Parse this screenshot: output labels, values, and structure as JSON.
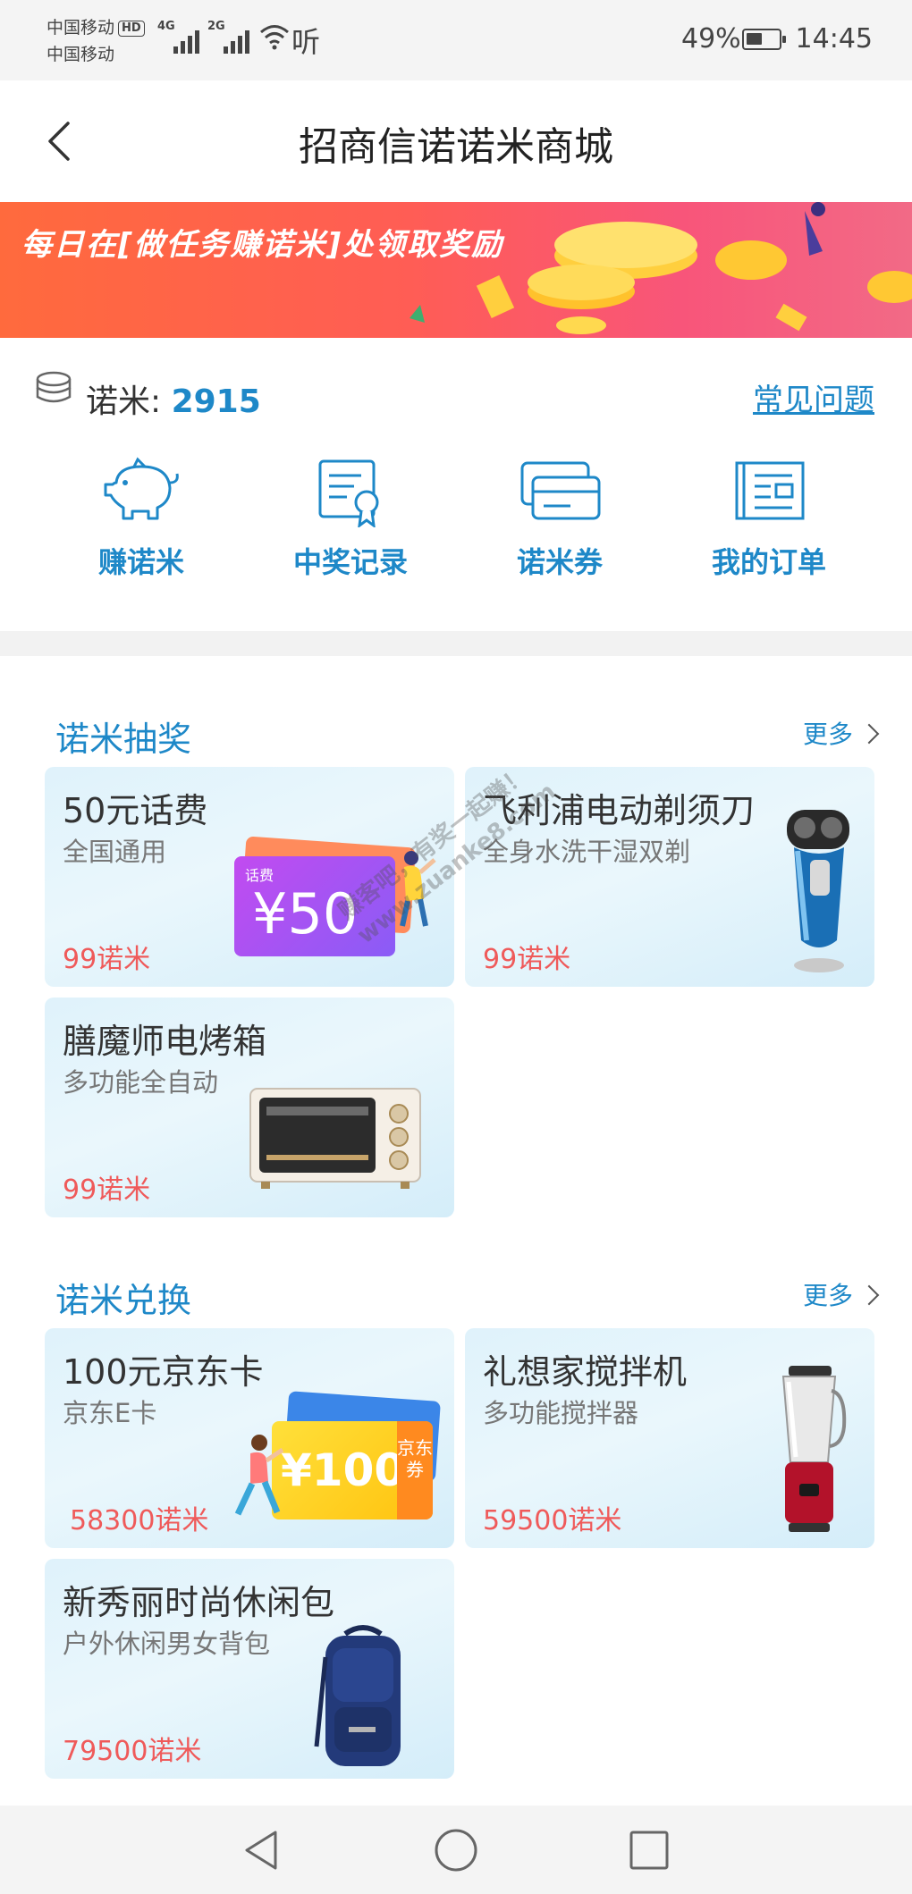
{
  "status_bar": {
    "carrier1": "中国移动",
    "hd": "HD",
    "carrier2": "中国移动",
    "net1": "4G",
    "net2": "2G",
    "listen": "听",
    "battery": "49%",
    "battery_level": 0.49,
    "time": "14:45"
  },
  "header": {
    "title": "招商信诺诺米商城"
  },
  "banner": {
    "text": "每日在[做任务赚诺米]处领取奖励"
  },
  "points": {
    "label": "诺米: ",
    "value": "2915",
    "faq": "常见问题"
  },
  "shortcuts": [
    {
      "label": "赚诺米",
      "icon": "piggy-bank-icon"
    },
    {
      "label": "中奖记录",
      "icon": "certificate-icon"
    },
    {
      "label": "诺米券",
      "icon": "coupon-icon"
    },
    {
      "label": "我的订单",
      "icon": "order-list-icon"
    }
  ],
  "lottery": {
    "title": "诺米抽奖",
    "more": "更多",
    "items": [
      {
        "name": "50元话费",
        "desc": "全国通用",
        "price": "99诺米",
        "art_tag": "话费",
        "art_value": "¥50"
      },
      {
        "name": "飞利浦电动剃须刀",
        "desc": "全身水洗干湿双剃",
        "price": "99诺米"
      },
      {
        "name": "膳魔师电烤箱",
        "desc": "多功能全自动",
        "price": "99诺米"
      }
    ]
  },
  "exchange": {
    "title": "诺米兑换",
    "more": "更多",
    "items": [
      {
        "name": "100元京东卡",
        "desc": "京东E卡",
        "price": "58300诺米",
        "art_value": "¥100",
        "art_tag": "京东券"
      },
      {
        "name": "礼想家搅拌机",
        "desc": "多功能搅拌器",
        "price": "59500诺米"
      },
      {
        "name": "新秀丽时尚休闲包",
        "desc": "户外休闲男女背包",
        "price": "79500诺米"
      }
    ]
  },
  "watermark": {
    "line1": "赚客吧，有奖一起赚！",
    "line2": "www.zuanke8.com"
  },
  "colors": {
    "accent": "#1e88c8",
    "price": "#ef5a5a",
    "banner": "#ff6a3d"
  }
}
